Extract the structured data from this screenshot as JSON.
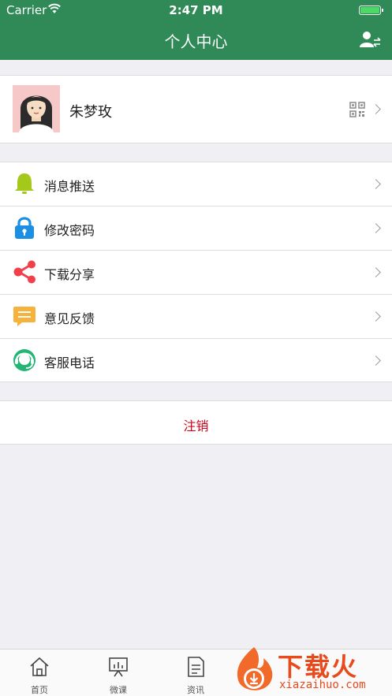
{
  "status_bar": {
    "carrier": "Carrier",
    "time": "2:47 PM"
  },
  "nav": {
    "title": "个人中心",
    "right_icon": "switch-user-icon"
  },
  "profile": {
    "name": "朱梦玫",
    "qr_icon": "qr-code-icon"
  },
  "menu": {
    "items": [
      {
        "label": "消息推送",
        "icon": "bell-icon",
        "color": "#a4c91a"
      },
      {
        "label": "修改密码",
        "icon": "lock-icon",
        "color": "#1a8fe3"
      },
      {
        "label": "下载分享",
        "icon": "share-icon",
        "color": "#f2404b"
      },
      {
        "label": "意见反馈",
        "icon": "feedback-icon",
        "color": "#f7b23c"
      },
      {
        "label": "客服电话",
        "icon": "headset-icon",
        "color": "#22b573"
      }
    ]
  },
  "logout": {
    "label": "注销",
    "color": "#d0021b"
  },
  "tabbar": {
    "tabs": [
      {
        "label": "首页",
        "icon": "home-icon"
      },
      {
        "label": "微课",
        "icon": "presentation-icon"
      },
      {
        "label": "资讯",
        "icon": "document-icon"
      }
    ]
  },
  "watermark": {
    "text": "下载火",
    "url": "xiazaihuo.com"
  },
  "colors": {
    "brand": "#2f8a57",
    "background": "#efeff4"
  }
}
